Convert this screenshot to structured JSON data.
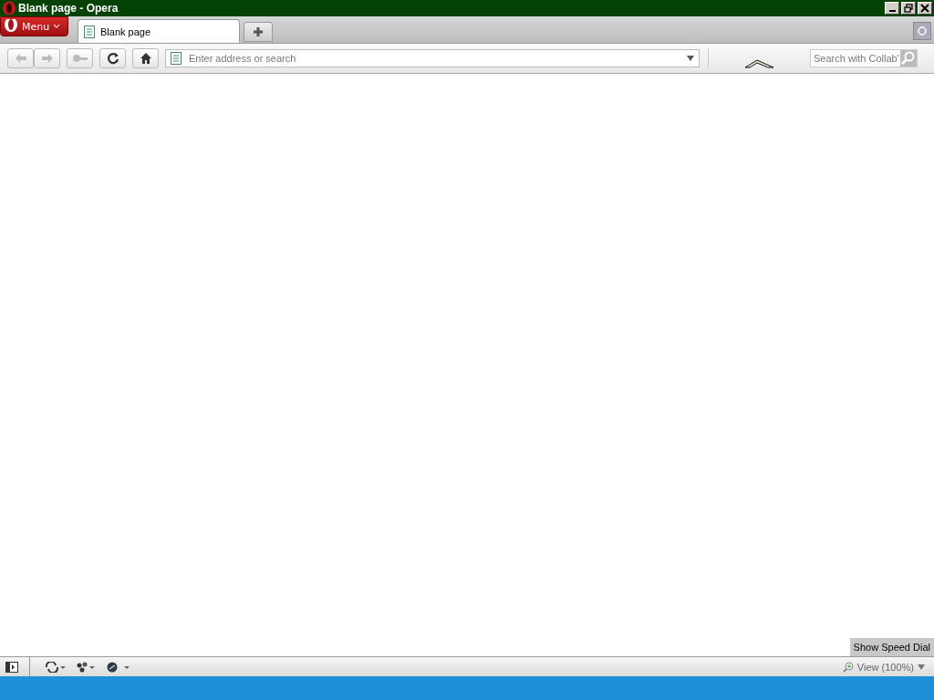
{
  "window": {
    "title": "Blank page - Opera"
  },
  "menu": {
    "label": "Menu"
  },
  "tabs": [
    {
      "label": "Blank page",
      "selected": true
    }
  ],
  "address": {
    "placeholder": "Enter address or search"
  },
  "search": {
    "placeholder": "Search with Collab'"
  },
  "speed_dial": {
    "label": "Show Speed Dial"
  },
  "status_bar": {
    "zoom": "View (100%)"
  }
}
